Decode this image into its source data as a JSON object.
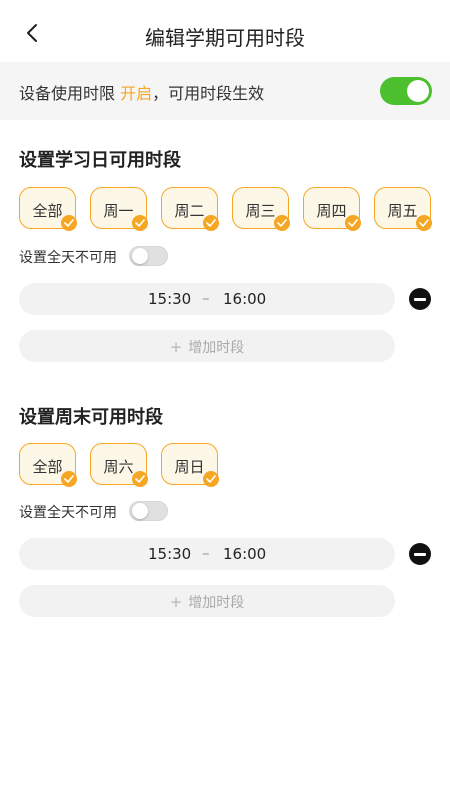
{
  "header": {
    "title": "编辑学期可用时段",
    "back_icon": "chevron-left-icon"
  },
  "limit_bar": {
    "prefix": "设备使用时限 ",
    "status": "开启",
    "suffix": "，可用时段生效",
    "toggle_on": true
  },
  "colors": {
    "accent": "#f5a623",
    "toggle_on": "#4cc02e",
    "chip_bg": "#fdf7e7"
  },
  "weekday": {
    "title": "设置学习日可用时段",
    "chips": [
      "全部",
      "周一",
      "周二",
      "周三",
      "周四",
      "周五"
    ],
    "all_day_label": "设置全天不可用",
    "all_day_toggle_on": false,
    "slot": {
      "start": "15:30",
      "dash": "–",
      "end": "16:00"
    },
    "add_plus": "+",
    "add_label": "增加时段"
  },
  "weekend": {
    "title": "设置周末可用时段",
    "chips": [
      "全部",
      "周六",
      "周日"
    ],
    "all_day_label": "设置全天不可用",
    "all_day_toggle_on": false,
    "slot": {
      "start": "15:30",
      "dash": "–",
      "end": "16:00"
    },
    "add_plus": "+",
    "add_label": "增加时段"
  }
}
